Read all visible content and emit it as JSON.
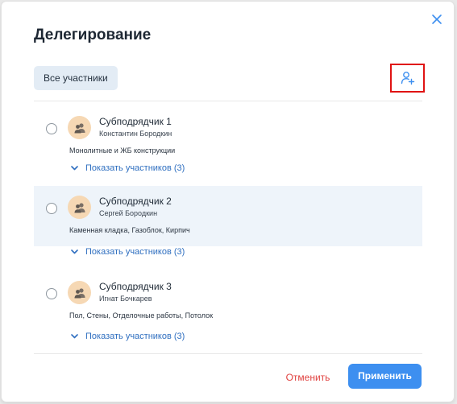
{
  "dialog": {
    "title": "Делегирование",
    "filter_chip": "Все участники",
    "items": [
      {
        "name": "Субподрядчик 1",
        "person": "Константин Бородкин",
        "work": "Монолитные и ЖБ конструкции",
        "show_label": "Показать участников (3)",
        "highlighted": false
      },
      {
        "name": "Субподрядчик 2",
        "person": "Сергей Бородкин",
        "work": "Каменная кладка, Газоблок, Кирпич",
        "show_label": "Показать участников (3)",
        "highlighted": true
      },
      {
        "name": "Субподрядчик 3",
        "person": "Игнат Бочкарев",
        "work": "Пол, Стены, Отделочные работы, Потолок",
        "show_label": "Показать участников (3)",
        "highlighted": false
      }
    ],
    "cancel_label": "Отменить",
    "apply_label": "Применить"
  },
  "icons": {
    "close": "close-icon",
    "add_user": "add-user-icon",
    "avatar": "group-users-icon",
    "chevron": "chevron-down-icon"
  },
  "colors": {
    "accent": "#3d8ff0",
    "link": "#2f6fc0",
    "cancel": "#e0413f",
    "highlight_row": "#eef4fa",
    "avatar_bg": "#f6d8b4",
    "chip_bg": "#e3ecf5",
    "add_user_border": "#e01313"
  }
}
